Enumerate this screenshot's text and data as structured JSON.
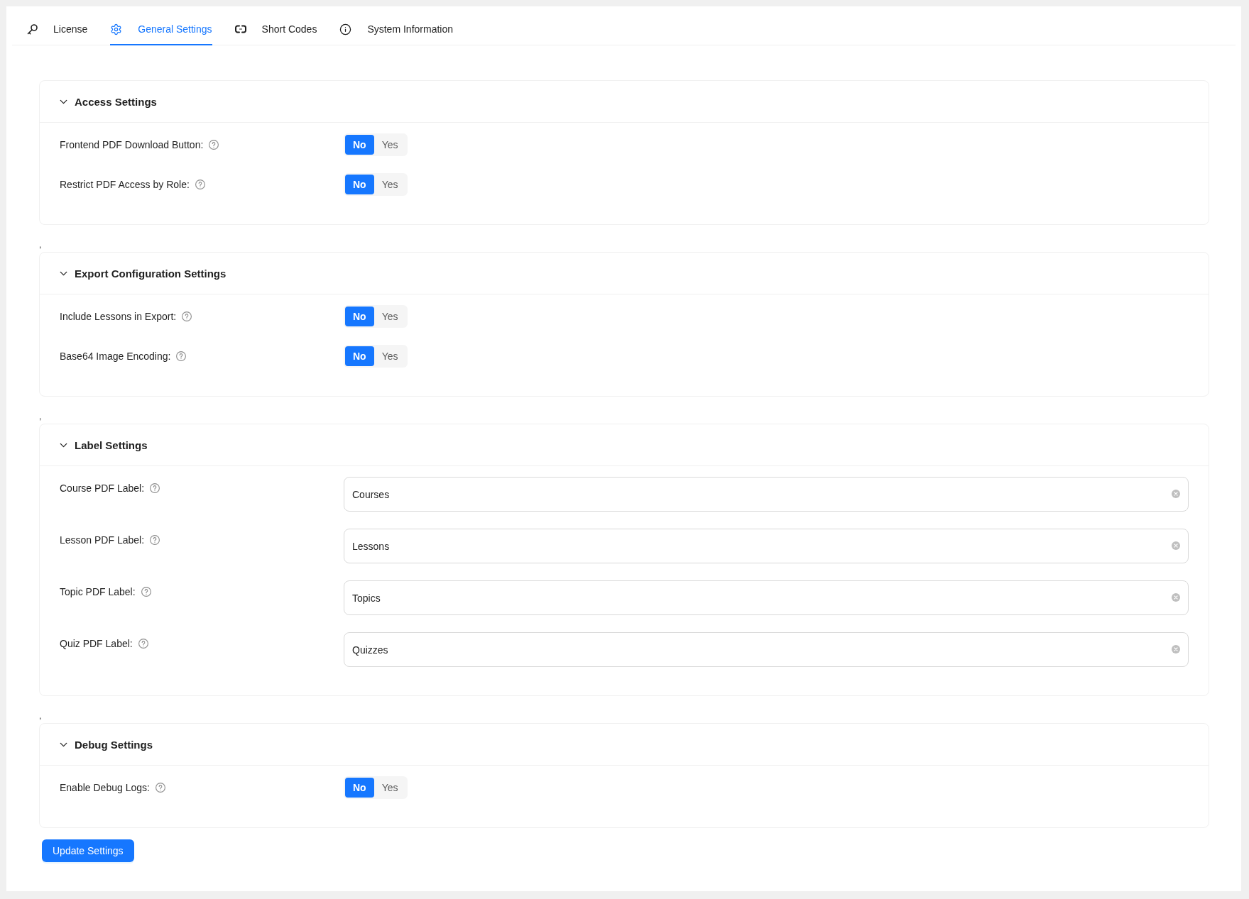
{
  "tabs": [
    {
      "label": "License",
      "selected": false
    },
    {
      "label": "General Settings",
      "selected": true
    },
    {
      "label": "Short Codes",
      "selected": false
    },
    {
      "label": "System Information",
      "selected": false
    }
  ],
  "sections": [
    {
      "title": "Access Settings",
      "expanded": true,
      "fields": [
        {
          "kind": "toggle",
          "label": "Frontend PDF Download Button:",
          "options": [
            {
              "label": "No",
              "selected": true
            },
            {
              "label": "Yes",
              "selected": false
            }
          ]
        },
        {
          "kind": "toggle",
          "label": "Restrict PDF Access by Role:",
          "options": [
            {
              "label": "No",
              "selected": true
            },
            {
              "label": "Yes",
              "selected": false
            }
          ]
        }
      ],
      "trailing_mark": ","
    },
    {
      "title": "Export Configuration Settings",
      "expanded": true,
      "fields": [
        {
          "kind": "toggle",
          "label": "Include Lessons in Export:",
          "options": [
            {
              "label": "No",
              "selected": true
            },
            {
              "label": "Yes",
              "selected": false
            }
          ]
        },
        {
          "kind": "toggle",
          "label": "Base64 Image Encoding:",
          "options": [
            {
              "label": "No",
              "selected": true
            },
            {
              "label": "Yes",
              "selected": false
            }
          ]
        }
      ],
      "trailing_mark": ","
    },
    {
      "title": "Label Settings",
      "expanded": true,
      "fields": [
        {
          "kind": "text",
          "label": "Course PDF Label:",
          "value": "Courses"
        },
        {
          "kind": "text",
          "label": "Lesson PDF Label:",
          "value": "Lessons"
        },
        {
          "kind": "text",
          "label": "Topic PDF Label:",
          "value": "Topics"
        },
        {
          "kind": "text",
          "label": "Quiz PDF Label:",
          "value": "Quizzes"
        }
      ],
      "trailing_mark": ","
    },
    {
      "title": "Debug Settings",
      "expanded": true,
      "fields": [
        {
          "kind": "toggle",
          "label": "Enable Debug Logs:",
          "options": [
            {
              "label": "No",
              "selected": true
            },
            {
              "label": "Yes",
              "selected": false
            }
          ]
        }
      ]
    }
  ],
  "submit_button": {
    "label": "Update Settings"
  }
}
